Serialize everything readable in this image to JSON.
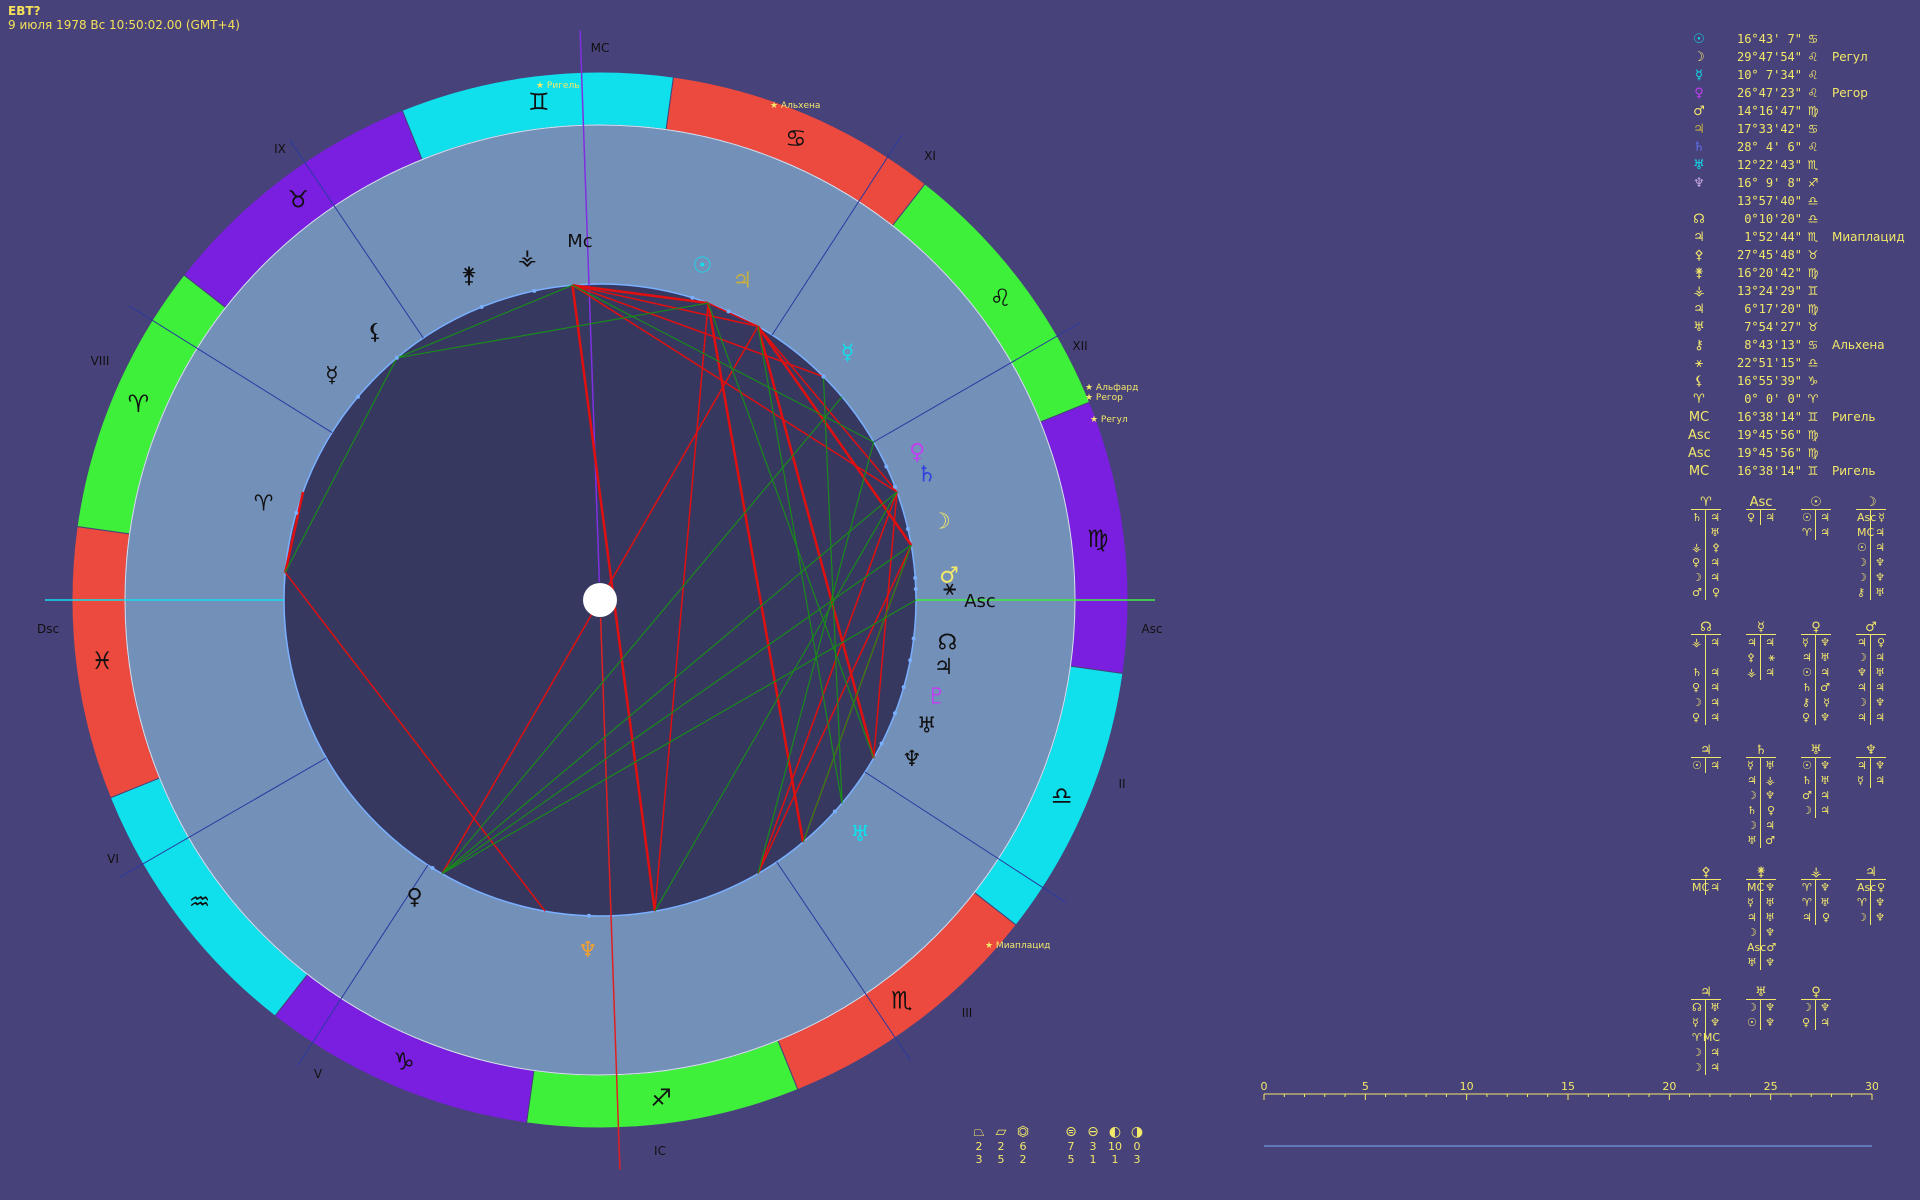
{
  "header": {
    "title": "ЕВТ?",
    "line": "9 июля 1978  Вс  10:50:02.00 (GMT+4)"
  },
  "house_labels": {
    "mc": "MC",
    "ic": "IC",
    "asc": "Asc",
    "dsc": "Dsc",
    "II": "II",
    "III": "III",
    "V": "V",
    "VI": "VI",
    "VIII": "VIII",
    "IX": "IX",
    "XI": "XI",
    "XII": "XII"
  },
  "wheel_labels": {
    "mc": "Mc",
    "asc": "Asc"
  },
  "signs": [
    {
      "glyph": "♊",
      "color": "#10e0ec"
    },
    {
      "glyph": "♋",
      "color": "#ec4a3e"
    },
    {
      "glyph": "♌",
      "color": "#3ef03a"
    },
    {
      "glyph": "♍",
      "color": "#7a1ee0"
    },
    {
      "glyph": "♎",
      "color": "#10e0ec"
    },
    {
      "glyph": "♏",
      "color": "#ec4a3e"
    },
    {
      "glyph": "♐",
      "color": "#3ef03a"
    },
    {
      "glyph": "♑",
      "color": "#7a1ee0"
    },
    {
      "glyph": "♒",
      "color": "#10e0ec"
    },
    {
      "glyph": "♓",
      "color": "#ec4a3e"
    },
    {
      "glyph": "♈",
      "color": "#3ef03a"
    },
    {
      "glyph": "♉",
      "color": "#7a1ee0"
    }
  ],
  "stars_on_wheel": [
    {
      "name": "Ригель"
    },
    {
      "name": "Альхена"
    },
    {
      "name": "Альфард"
    },
    {
      "name": "Регор"
    },
    {
      "name": "Регул"
    },
    {
      "name": "Миаплацид"
    }
  ],
  "planets_on_wheel": [
    {
      "glyph": "☉",
      "color": "#10e0ec"
    },
    {
      "glyph": "♃",
      "color": "#c8b040"
    },
    {
      "glyph": "☿",
      "color": "#10e0ec"
    },
    {
      "glyph": "♀",
      "color": "#c040f0"
    },
    {
      "glyph": "♄",
      "color": "#3040e0"
    },
    {
      "glyph": "☽",
      "color": "#f2e86a"
    },
    {
      "glyph": "♂",
      "color": "#f2e86a"
    },
    {
      "glyph": "⚹",
      "color": "#101010"
    },
    {
      "glyph": "☊",
      "color": "#101010"
    },
    {
      "glyph": "♃",
      "color": "#101010"
    },
    {
      "glyph": "♇",
      "color": "#c040f0"
    },
    {
      "glyph": "♅",
      "color": "#101010"
    },
    {
      "glyph": "♆",
      "color": "#101010"
    },
    {
      "glyph": "♅",
      "color": "#10e0ec"
    },
    {
      "glyph": "♆",
      "color": "#f0a030"
    },
    {
      "glyph": "♀",
      "color": "#101010"
    },
    {
      "glyph": "♈",
      "color": "#101010"
    },
    {
      "glyph": "☿",
      "color": "#101010"
    },
    {
      "glyph": "⚸",
      "color": "#101010"
    },
    {
      "glyph": "⚵",
      "color": "#101010"
    },
    {
      "glyph": "⚶",
      "color": "#101010"
    }
  ],
  "planet_table": [
    {
      "glyph": "☉",
      "color": "#10e0ec",
      "pos": "16°43' 7\"",
      "sign": "♋",
      "star": ""
    },
    {
      "glyph": "☽",
      "color": "#f2e86a",
      "pos": "29°47'54\"",
      "sign": "♌",
      "star": "Регул"
    },
    {
      "glyph": "☿",
      "color": "#10e0ec",
      "pos": "10° 7'34\"",
      "sign": "♌",
      "star": ""
    },
    {
      "glyph": "♀",
      "color": "#c040f0",
      "pos": "26°47'23\"",
      "sign": "♌",
      "star": "Регор"
    },
    {
      "glyph": "♂",
      "color": "#f2e86a",
      "pos": "14°16'47\"",
      "sign": "♍",
      "star": ""
    },
    {
      "glyph": "♃",
      "color": "#c8b040",
      "pos": "17°33'42\"",
      "sign": "♋",
      "star": ""
    },
    {
      "glyph": "♄",
      "color": "#6070f0",
      "pos": "28° 4' 6\"",
      "sign": "♌",
      "star": ""
    },
    {
      "glyph": "♅",
      "color": "#10e0ec",
      "pos": "12°22'43\"",
      "sign": "♏",
      "star": ""
    },
    {
      "glyph": "♆",
      "color": "#c8a8e0",
      "pos": "16° 9' 8\"",
      "sign": "♐",
      "star": ""
    },
    {
      "glyph": "",
      "color": "#f2e86a",
      "pos": "13°57'40\"",
      "sign": "♎",
      "star": ""
    },
    {
      "glyph": "☊",
      "color": "#f2e86a",
      "pos": "0°10'20\"",
      "sign": "♎",
      "star": ""
    },
    {
      "glyph": "♃",
      "color": "#f2e86a",
      "pos": "1°52'44\"",
      "sign": "♏",
      "star": "Миаплацид"
    },
    {
      "glyph": "⚴",
      "color": "#f2e86a",
      "pos": "27°45'48\"",
      "sign": "♉",
      "star": ""
    },
    {
      "glyph": "⚵",
      "color": "#f2e86a",
      "pos": "16°20'42\"",
      "sign": "♍",
      "star": ""
    },
    {
      "glyph": "⚶",
      "color": "#f2e86a",
      "pos": "13°24'29\"",
      "sign": "♊",
      "star": ""
    },
    {
      "glyph": "♃",
      "color": "#f2e86a",
      "pos": "6°17'20\"",
      "sign": "♍",
      "star": ""
    },
    {
      "glyph": "♅",
      "color": "#f2e86a",
      "pos": "7°54'27\"",
      "sign": "♉",
      "star": ""
    },
    {
      "glyph": "⚷",
      "color": "#f2e86a",
      "pos": "8°43'13\"",
      "sign": "♋",
      "star": "Альхена"
    },
    {
      "glyph": "⚹",
      "color": "#f2e86a",
      "pos": "22°51'15\"",
      "sign": "♎",
      "star": ""
    },
    {
      "glyph": "⚸",
      "color": "#f2e86a",
      "pos": "16°55'39\"",
      "sign": "♑",
      "star": ""
    },
    {
      "glyph": "♈",
      "color": "#f2e86a",
      "pos": "0° 0' 0\"",
      "sign": "♈",
      "star": ""
    },
    {
      "glyph": "MC",
      "color": "#f2e86a",
      "pos": "16°38'14\"",
      "sign": "♊",
      "star": "Ригель"
    },
    {
      "glyph": "Asc",
      "color": "#f2e86a",
      "pos": "19°45'56\"",
      "sign": "♍",
      "star": ""
    },
    {
      "glyph": "Asc",
      "color": "#f2e86a",
      "pos": "19°45'56\"",
      "sign": "♍",
      "star": ""
    },
    {
      "glyph": "MC",
      "color": "#f2e86a",
      "pos": "16°38'14\"",
      "sign": "♊",
      "star": "Ригель"
    }
  ],
  "rulers": [
    {
      "head": "♈",
      "items": [
        [
          "♄",
          "♃"
        ],
        [
          "",
          "♅"
        ],
        [
          "⚶",
          "⚴"
        ],
        [
          "♀",
          "♃"
        ],
        [
          "☽",
          "♃"
        ],
        [
          "♂",
          "♀"
        ]
      ]
    },
    {
      "head": "Asc",
      "items": [
        [
          "♀",
          "♃"
        ]
      ]
    },
    {
      "head": "☉",
      "items": [
        [
          "☉",
          "♃"
        ],
        [
          "♈",
          "♃"
        ]
      ]
    },
    {
      "head": "☽",
      "items": [
        [
          "Asc",
          "☿"
        ],
        [
          "MC",
          "♃"
        ],
        [
          "☉",
          "♃"
        ],
        [
          "☽",
          "♆"
        ],
        [
          "☽",
          "♆"
        ],
        [
          "⚷",
          "♅"
        ]
      ]
    },
    {
      "head": "☊",
      "items": [
        [
          "⚶",
          "♃"
        ],
        [
          "",
          ""
        ],
        [
          "♄",
          "♃"
        ],
        [
          "♀",
          "♃"
        ],
        [
          "☽",
          "♃"
        ],
        [
          "♀",
          "♃"
        ]
      ]
    },
    {
      "head": "☿",
      "items": [
        [
          "♃",
          "♃"
        ],
        [
          "⚴",
          "⚹"
        ],
        [
          "⚶",
          "♃"
        ]
      ]
    },
    {
      "head": "♀",
      "items": [
        [
          "☿",
          "♆"
        ],
        [
          "♃",
          "♅"
        ],
        [
          "☉",
          "♃"
        ],
        [
          "♄",
          "♂"
        ],
        [
          "⚷",
          "☿"
        ],
        [
          "♀",
          "♆"
        ]
      ]
    },
    {
      "head": "♂",
      "items": [
        [
          "♃",
          "♀"
        ],
        [
          "☽",
          "♃"
        ],
        [
          "♆",
          "♅"
        ],
        [
          "♃",
          "♃"
        ],
        [
          "☽",
          "♆"
        ],
        [
          "♃",
          "♃"
        ]
      ]
    },
    {
      "head": "♃",
      "items": [
        [
          "☉",
          "♃"
        ]
      ]
    },
    {
      "head": "♄",
      "items": [
        [
          "☿",
          "♅"
        ],
        [
          "♃",
          "⚶"
        ],
        [
          "☽",
          "♆"
        ],
        [
          "♄",
          "♀"
        ],
        [
          "☽",
          "♃"
        ],
        [
          "♅",
          "♂"
        ]
      ]
    },
    {
      "head": "♅",
      "items": [
        [
          "☉",
          "♆"
        ],
        [
          "♄",
          "♅"
        ],
        [
          "♂",
          "♃"
        ],
        [
          "☽",
          "♃"
        ]
      ]
    },
    {
      "head": "♆",
      "items": [
        [
          "♃",
          "♆"
        ],
        [
          "☿",
          "♃"
        ]
      ]
    },
    {
      "head": "⚴",
      "items": [
        [
          "MC",
          "♃"
        ]
      ]
    },
    {
      "head": "⚵",
      "items": [
        [
          "MC",
          "♆"
        ],
        [
          "☿",
          "♅"
        ],
        [
          "♃",
          "♅"
        ],
        [
          "☽",
          "♆"
        ],
        [
          "Asc",
          "♂"
        ],
        [
          "♅",
          "♆"
        ]
      ]
    },
    {
      "head": "⚶",
      "items": [
        [
          "♈",
          "♆"
        ],
        [
          "♈",
          "♅"
        ],
        [
          "♃",
          "♀"
        ]
      ]
    },
    {
      "head": "♃",
      "items": [
        [
          "Asc",
          "♀"
        ],
        [
          "♈",
          "♆"
        ],
        [
          "☽",
          "♆"
        ]
      ]
    },
    {
      "head": "♃",
      "items": [
        [
          "☊",
          "♅"
        ],
        [
          "☿",
          "♆"
        ],
        [
          "♈",
          "MC"
        ],
        [
          "☽",
          "♃"
        ],
        [
          "☽",
          "♃"
        ]
      ]
    },
    {
      "head": "♅",
      "items": [
        [
          "☽",
          "♆"
        ],
        [
          "☉",
          "♆"
        ]
      ]
    },
    {
      "head": "♀",
      "items": [
        [
          "☽",
          "♆"
        ],
        [
          "♀",
          "♃"
        ]
      ]
    }
  ],
  "degree_scale": {
    "ticks": [
      "0",
      "5",
      "10",
      "15",
      "20",
      "25",
      "30"
    ]
  },
  "aspect_stats": [
    {
      "glyph": "⏢",
      "top": "2",
      "bottom": "3"
    },
    {
      "glyph": "⏥",
      "top": "2",
      "bottom": "5"
    },
    {
      "glyph": "⏣",
      "top": "6",
      "bottom": "2"
    },
    {
      "glyph": "⊜",
      "top": "7",
      "bottom": "5"
    },
    {
      "glyph": "⊖",
      "top": "3",
      "bottom": "1"
    },
    {
      "glyph": "◐",
      "top": "10",
      "bottom": "1"
    },
    {
      "glyph": "◑",
      "top": "0",
      "bottom": "3"
    }
  ],
  "colors": {
    "background": "#48427a",
    "inner_circle": "#363860",
    "house_ring": "#7390b8",
    "aspect_red": "#e01010",
    "aspect_green": "#1a8a1a",
    "text_yellow": "#f2e86a"
  }
}
